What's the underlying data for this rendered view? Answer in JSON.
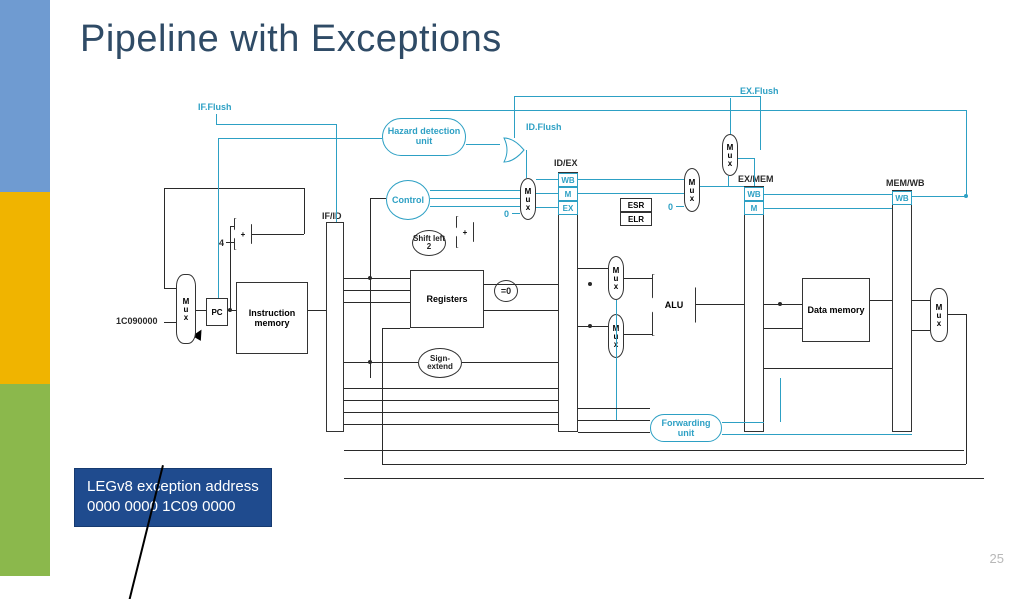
{
  "title": "Pipeline with Exceptions",
  "page_number": "25",
  "callout": {
    "line1": "LEGv8 exception address",
    "line2": "0000 0000 1C09 0000"
  },
  "flush_labels": {
    "if": "IF.Flush",
    "id": "ID.Flush",
    "ex": "EX.Flush"
  },
  "stage_labels": {
    "ifid": "IF/ID",
    "idex": "ID/EX",
    "exmem": "EX/MEM",
    "memwb": "MEM/WB"
  },
  "mini": {
    "wb": "WB",
    "m": "M",
    "ex": "EX"
  },
  "blocks": {
    "hazard": "Hazard detection unit",
    "control": "Control",
    "forwarding": "Forwarding unit",
    "mux": "Mux",
    "pc": "PC",
    "imem": "Instruction memory",
    "regs": "Registers",
    "signext": "Sign- extend",
    "shl2": "Shift left 2",
    "alu": "ALU",
    "dmem": "Data memory",
    "esr": "ESR",
    "elr": "ELR",
    "eqz": "=0",
    "add": "+"
  },
  "const": {
    "four": "4",
    "zero": "0",
    "entry": "1C090000"
  }
}
